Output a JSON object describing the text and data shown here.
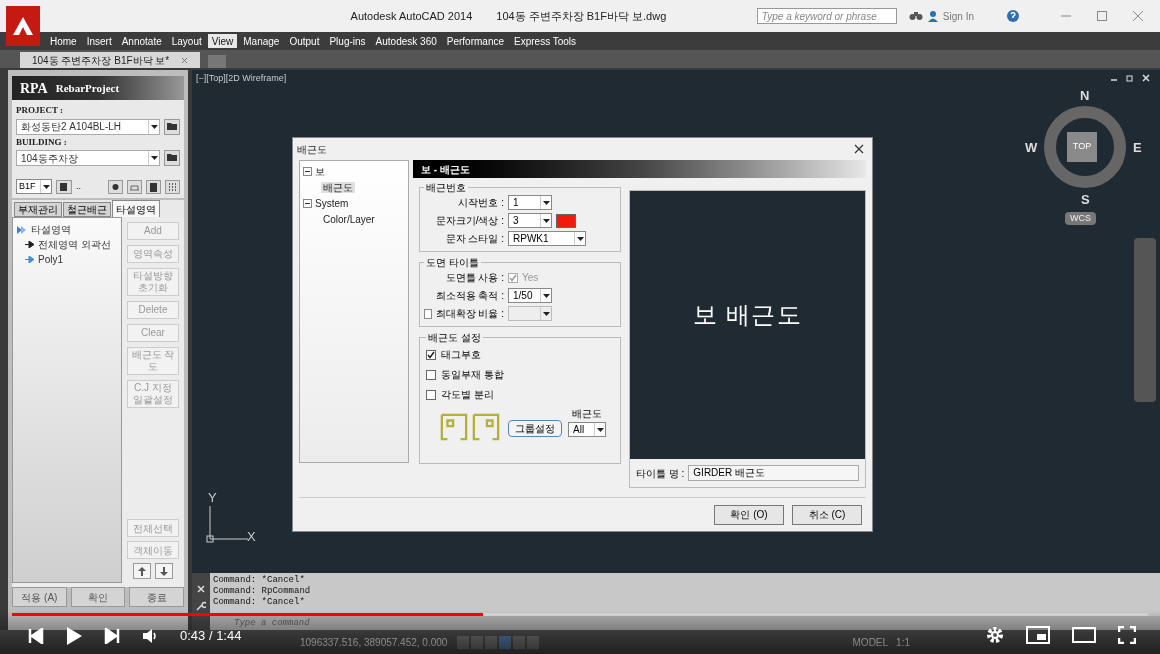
{
  "app_title": "Autodesk AutoCAD 2014",
  "file_title": "104동 주변주차장 B1F바닥 보.dwg",
  "search": {
    "placeholder": "Type a keyword or phrase"
  },
  "sign_in": "Sign In",
  "ribbon_tabs": [
    {
      "label": "Home",
      "selected": false
    },
    {
      "label": "Insert",
      "selected": false
    },
    {
      "label": "Annotate",
      "selected": false
    },
    {
      "label": "Layout",
      "selected": false
    },
    {
      "label": "View",
      "selected": true
    },
    {
      "label": "Manage",
      "selected": false
    },
    {
      "label": "Output",
      "selected": false
    },
    {
      "label": "Plug-ins",
      "selected": false
    },
    {
      "label": "Autodesk 360",
      "selected": false
    },
    {
      "label": "Performance",
      "selected": false
    },
    {
      "label": "Express Tools",
      "selected": false
    }
  ],
  "doc_tab": "104동 주변주차장 B1F바닥 보*",
  "viewport_label": "[−][Top][2D Wireframe]",
  "viewcube": {
    "n": "N",
    "s": "S",
    "e": "E",
    "w": "W",
    "top": "TOP",
    "wcs": "WCS"
  },
  "ucs": {
    "x": "X",
    "y": "Y"
  },
  "left_panel": {
    "logo": "RPA",
    "title": "RebarProject",
    "project_label": "PROJECT :",
    "project": "화성동탄2 A104BL-LH",
    "building_label": "BUILDING :",
    "building": "104동주차장",
    "floor": "B1F",
    "dots": "..",
    "tabs": [
      {
        "label": "부재관리",
        "selected": false
      },
      {
        "label": "철근배근",
        "selected": false
      },
      {
        "label": "타설영역",
        "selected": true
      }
    ],
    "tree": [
      {
        "label": "타설영역",
        "children": [
          {
            "label": "전체영역 외곽선",
            "kind": "outline"
          },
          {
            "label": "Poly1",
            "kind": "poly"
          }
        ]
      }
    ],
    "side_buttons": [
      {
        "label": "Add",
        "disabled": true
      },
      {
        "label": "영역속성",
        "disabled": true
      },
      {
        "label": "타설방향 초기화",
        "disabled": true
      },
      {
        "label": "Delete",
        "disabled": true
      },
      {
        "label": "Clear",
        "disabled": true
      },
      {
        "label": "배근도 작도",
        "disabled": true
      },
      {
        "label": "C.J 지정 일괄설정",
        "disabled": true
      }
    ],
    "lower_buttons": [
      {
        "label": "전체선택",
        "disabled": true
      },
      {
        "label": "객체이동",
        "disabled": true
      }
    ],
    "bottom_buttons": [
      {
        "label": "적용 (A)"
      },
      {
        "label": "확인"
      },
      {
        "label": "종료"
      }
    ]
  },
  "dialog": {
    "title": "배근도",
    "tree": [
      {
        "label": "보",
        "expanded": true,
        "children": [
          {
            "label": "배근도",
            "selected": true
          }
        ]
      },
      {
        "label": "System",
        "expanded": true,
        "children": [
          {
            "label": "Color/Layer",
            "selected": false
          }
        ]
      }
    ],
    "header": "보 - 배근도",
    "group_number": {
      "title": "배근번호",
      "start_label": "시작번호 :",
      "start": "1",
      "size_label": "문자크기/색상 :",
      "size": "3",
      "color": "#ee1c0c",
      "style_label": "문자 스타일 :",
      "style": "RPWK1"
    },
    "group_title": {
      "title": "도면 타이틀",
      "frame_label": "도면틀 사용 :",
      "frame_checked": true,
      "frame_text": "Yes",
      "min_label": "최소적용 축적 :",
      "min": "1/50",
      "max_label": "최대확장 비율 :",
      "max_checked": false
    },
    "group_settings": {
      "title": "배근도 설정",
      "checks": [
        {
          "label": "태그부호",
          "checked": true
        },
        {
          "label": "동일부재 통합",
          "checked": false
        },
        {
          "label": "각도별 분리",
          "checked": false
        }
      ],
      "group_button": "그룹설정",
      "select_label": "배근도",
      "select": "All"
    },
    "preview_text": "보 배근도",
    "title_name_label": "타이틀 명 :",
    "title_name": "GIRDER 배근도",
    "buttons": [
      "확인 (O)",
      "취소 (C)"
    ]
  },
  "command_lines": [
    "Command: *Cancel*",
    "Command: RpCommand",
    "Command: *Cancel*"
  ],
  "command_placeholder": "Type a command",
  "coordinates": "1096337.516, 389057.452, 0.000",
  "status": {
    "model": "MODEL",
    "scale": "1:1"
  },
  "player": {
    "time": "0:43 / 1:44",
    "level": 0.415
  }
}
